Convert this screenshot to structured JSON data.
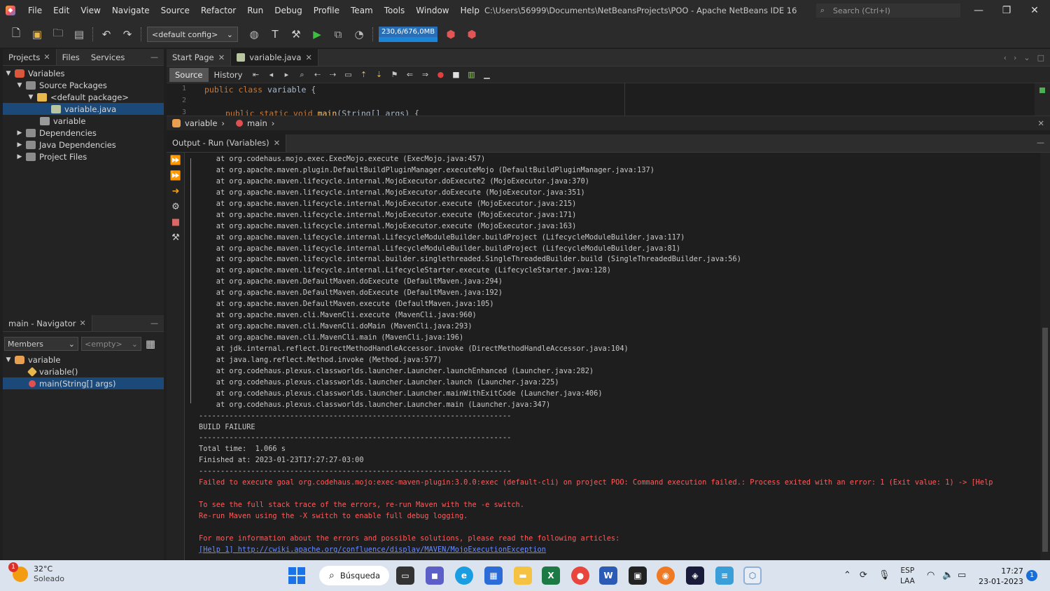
{
  "titlebar": {
    "menu": [
      "File",
      "Edit",
      "View",
      "Navigate",
      "Source",
      "Refactor",
      "Run",
      "Debug",
      "Profile",
      "Team",
      "Tools",
      "Window",
      "Help"
    ],
    "window_title": "C:\\Users\\56999\\Documents\\NetBeansProjects\\POO - Apache NetBeans IDE 16",
    "search_placeholder": "Search (Ctrl+I)"
  },
  "toolbar": {
    "config": "<default config>",
    "memory": "230,6/676,0MB"
  },
  "projects_panel": {
    "tabs": [
      "Projects",
      "Files",
      "Services"
    ],
    "tree": [
      {
        "label": "Variables",
        "expanded": true,
        "level": 0
      },
      {
        "label": "Source Packages",
        "expanded": true,
        "level": 1
      },
      {
        "label": "<default package>",
        "expanded": true,
        "level": 2
      },
      {
        "label": "variable.java",
        "level": 3,
        "selected": true
      },
      {
        "label": "variable",
        "level": 2
      },
      {
        "label": "Dependencies",
        "level": 1
      },
      {
        "label": "Java Dependencies",
        "level": 1
      },
      {
        "label": "Project Files",
        "level": 1
      }
    ]
  },
  "navigator_panel": {
    "tab": "main - Navigator",
    "filter": "Members",
    "filter2": "<empty>",
    "tree": [
      {
        "label": "variable",
        "level": 0
      },
      {
        "label": "variable()",
        "level": 1
      },
      {
        "label": "main(String[] args)",
        "level": 1,
        "selected": true
      }
    ]
  },
  "editor": {
    "tabs": [
      "Start Page",
      "variable.java"
    ],
    "view_buttons": [
      "Source",
      "History"
    ],
    "line_numbers": [
      "1",
      "2",
      "3"
    ],
    "code": {
      "l1_kw": "public class",
      "l1_rest": " variable {",
      "l3_kw": "public static void",
      "l3_fn": "main",
      "l3_rest": "(String[] args) {"
    },
    "breadcrumb": [
      "variable",
      "main"
    ]
  },
  "output": {
    "tab": "Output - Run (Variables)",
    "lines": [
      {
        "t": "    at org.codehaus.mojo.exec.ExecMojo.execute (ExecMojo.java:457)",
        "c": "n"
      },
      {
        "t": "    at org.apache.maven.plugin.DefaultBuildPluginManager.executeMojo (DefaultBuildPluginManager.java:137)",
        "c": "n"
      },
      {
        "t": "    at org.apache.maven.lifecycle.internal.MojoExecutor.doExecute2 (MojoExecutor.java:370)",
        "c": "n"
      },
      {
        "t": "    at org.apache.maven.lifecycle.internal.MojoExecutor.doExecute (MojoExecutor.java:351)",
        "c": "n"
      },
      {
        "t": "    at org.apache.maven.lifecycle.internal.MojoExecutor.execute (MojoExecutor.java:215)",
        "c": "n"
      },
      {
        "t": "    at org.apache.maven.lifecycle.internal.MojoExecutor.execute (MojoExecutor.java:171)",
        "c": "n"
      },
      {
        "t": "    at org.apache.maven.lifecycle.internal.MojoExecutor.execute (MojoExecutor.java:163)",
        "c": "n"
      },
      {
        "t": "    at org.apache.maven.lifecycle.internal.LifecycleModuleBuilder.buildProject (LifecycleModuleBuilder.java:117)",
        "c": "n"
      },
      {
        "t": "    at org.apache.maven.lifecycle.internal.LifecycleModuleBuilder.buildProject (LifecycleModuleBuilder.java:81)",
        "c": "n"
      },
      {
        "t": "    at org.apache.maven.lifecycle.internal.builder.singlethreaded.SingleThreadedBuilder.build (SingleThreadedBuilder.java:56)",
        "c": "n"
      },
      {
        "t": "    at org.apache.maven.lifecycle.internal.LifecycleStarter.execute (LifecycleStarter.java:128)",
        "c": "n"
      },
      {
        "t": "    at org.apache.maven.DefaultMaven.doExecute (DefaultMaven.java:294)",
        "c": "n"
      },
      {
        "t": "    at org.apache.maven.DefaultMaven.doExecute (DefaultMaven.java:192)",
        "c": "n"
      },
      {
        "t": "    at org.apache.maven.DefaultMaven.execute (DefaultMaven.java:105)",
        "c": "n"
      },
      {
        "t": "    at org.apache.maven.cli.MavenCli.execute (MavenCli.java:960)",
        "c": "n"
      },
      {
        "t": "    at org.apache.maven.cli.MavenCli.doMain (MavenCli.java:293)",
        "c": "n"
      },
      {
        "t": "    at org.apache.maven.cli.MavenCli.main (MavenCli.java:196)",
        "c": "n"
      },
      {
        "t": "    at jdk.internal.reflect.DirectMethodHandleAccessor.invoke (DirectMethodHandleAccessor.java:104)",
        "c": "n"
      },
      {
        "t": "    at java.lang.reflect.Method.invoke (Method.java:577)",
        "c": "n"
      },
      {
        "t": "    at org.codehaus.plexus.classworlds.launcher.Launcher.launchEnhanced (Launcher.java:282)",
        "c": "n"
      },
      {
        "t": "    at org.codehaus.plexus.classworlds.launcher.Launcher.launch (Launcher.java:225)",
        "c": "n"
      },
      {
        "t": "    at org.codehaus.plexus.classworlds.launcher.Launcher.mainWithExitCode (Launcher.java:406)",
        "c": "n"
      },
      {
        "t": "    at org.codehaus.plexus.classworlds.launcher.Launcher.main (Launcher.java:347)",
        "c": "n"
      },
      {
        "t": "------------------------------------------------------------------------",
        "c": "n"
      },
      {
        "t": "BUILD FAILURE",
        "c": "n"
      },
      {
        "t": "------------------------------------------------------------------------",
        "c": "n"
      },
      {
        "t": "Total time:  1.066 s",
        "c": "n"
      },
      {
        "t": "Finished at: 2023-01-23T17:27:27-03:00",
        "c": "n"
      },
      {
        "t": "------------------------------------------------------------------------",
        "c": "n"
      },
      {
        "t": "Failed to execute goal org.codehaus.mojo:exec-maven-plugin:3.0.0:exec (default-cli) on project POO: Command execution failed.: Process exited with an error: 1 (Exit value: 1) -> [Help",
        "c": "e"
      },
      {
        "t": "",
        "c": "n"
      },
      {
        "t": "To see the full stack trace of the errors, re-run Maven with the -e switch.",
        "c": "e"
      },
      {
        "t": "Re-run Maven using the -X switch to enable full debug logging.",
        "c": "e"
      },
      {
        "t": "",
        "c": "n"
      },
      {
        "t": "For more information about the errors and possible solutions, please read the following articles:",
        "c": "e"
      },
      {
        "t": "[Help 1] http://cwiki.apache.org/confluence/display/MAVEN/MojoExecutionException",
        "c": "l"
      }
    ]
  },
  "taskbar": {
    "temp": "32°C",
    "weather": "Soleado",
    "weather_badge": "1",
    "search": "Búsqueda",
    "lang1": "ESP",
    "lang2": "LAA",
    "time": "17:27",
    "date": "23-01-2023",
    "notifications": "1"
  }
}
